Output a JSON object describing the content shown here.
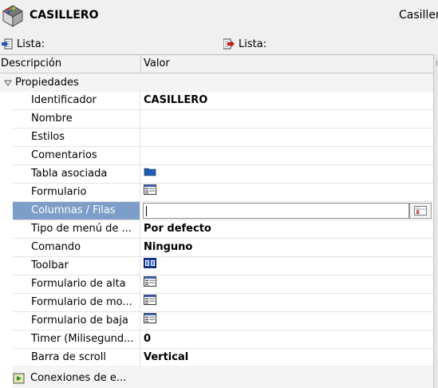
{
  "header": {
    "title": "CASILLERO",
    "title_right": "Casiller",
    "logo_icon": "object-cube-icon"
  },
  "lista_bar": {
    "left_label": "Lista:",
    "right_label": "Lista:",
    "left_icon": "import-list-icon",
    "right_icon": "export-list-icon"
  },
  "grid": {
    "col_description": "Descripción",
    "col_value": "Valor",
    "group_label": "Propiedades",
    "rows": [
      {
        "name": "Identificador",
        "value": "CASILLERO",
        "icon": ""
      },
      {
        "name": "Nombre",
        "value": "",
        "icon": ""
      },
      {
        "name": "Estilos",
        "value": "",
        "icon": ""
      },
      {
        "name": "Comentarios",
        "value": "",
        "icon": ""
      },
      {
        "name": "Tabla asociada",
        "value": "",
        "icon": "folder-icon"
      },
      {
        "name": "Formulario",
        "value": "",
        "icon": "form-icon"
      },
      {
        "name": "Columnas / Filas",
        "value": "",
        "icon": "",
        "selected": true
      },
      {
        "name": "Tipo de menú de ...",
        "value": "Por defecto",
        "icon": ""
      },
      {
        "name": "Comando",
        "value": "Ninguno",
        "icon": ""
      },
      {
        "name": "Toolbar",
        "value": "",
        "icon": "toolbar-icon"
      },
      {
        "name": "Formulario de alta",
        "value": "",
        "icon": "form-icon"
      },
      {
        "name": "Formulario de mo...",
        "value": "",
        "icon": "form-icon"
      },
      {
        "name": "Formulario de baja",
        "value": "",
        "icon": "form-icon"
      },
      {
        "name": "Timer (Milisegund...",
        "value": "0",
        "icon": ""
      },
      {
        "name": "Barra de scroll",
        "value": "Vertical",
        "icon": ""
      }
    ],
    "bottom_group_label": "Conexiones de e..."
  },
  "colors": {
    "selection": "#7d9ec8",
    "folder": "#1f5fb5",
    "toolbar": "#1a3fa0"
  }
}
